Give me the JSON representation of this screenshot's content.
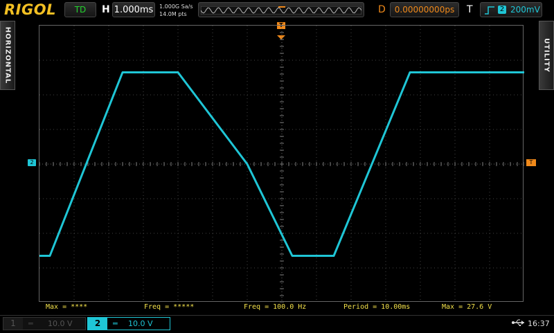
{
  "brand": "RIGOL",
  "run_status": "TD",
  "horizontal": {
    "letter": "H",
    "timebase": "1.000ms"
  },
  "sample_rate": "1.000G Sa/s",
  "mem_depth": "14.0M pts",
  "delay": {
    "letter": "D",
    "value": "0.00000000ps"
  },
  "trigger": {
    "letter": "T",
    "source_channel": "2",
    "level": "200mV"
  },
  "side_tabs": {
    "left": "HORIZONTAL",
    "right": "UTILITY"
  },
  "markers": {
    "channel": "2",
    "trigger_pos": "T",
    "trigger_level": "T"
  },
  "measurements": [
    "Max = ****",
    "Freq = *****",
    "Freq = 100.0 Hz",
    "Period = 10.00ms",
    "Max = 27.6 V"
  ],
  "channels": [
    {
      "num": "1",
      "coupling": "═",
      "scale": "10.0 V",
      "active": false
    },
    {
      "num": "2",
      "coupling": "═",
      "scale": "10.0 V",
      "active": true
    }
  ],
  "status": {
    "usb_icon": "⇠",
    "time": "16:37"
  },
  "colors": {
    "ch2": "#1fc6d6",
    "trigger": "#f0891a",
    "measure": "#f3e14a",
    "logo": "#f3c023"
  },
  "waveform": {
    "channel": "2",
    "shape": "clipped triangle (trapezoid)",
    "timebase_per_div": "1.000ms",
    "volts_per_div": "10.0 V",
    "time_div": [
      0,
      0.3,
      2.4,
      4.0,
      6.0,
      7.3,
      8.5,
      10.7,
      12.0,
      14.0
    ],
    "voltage_div": [
      -2.65,
      -2.65,
      2.65,
      2.65,
      0,
      -2.65,
      -2.65,
      2.65,
      2.65,
      2.65
    ]
  }
}
